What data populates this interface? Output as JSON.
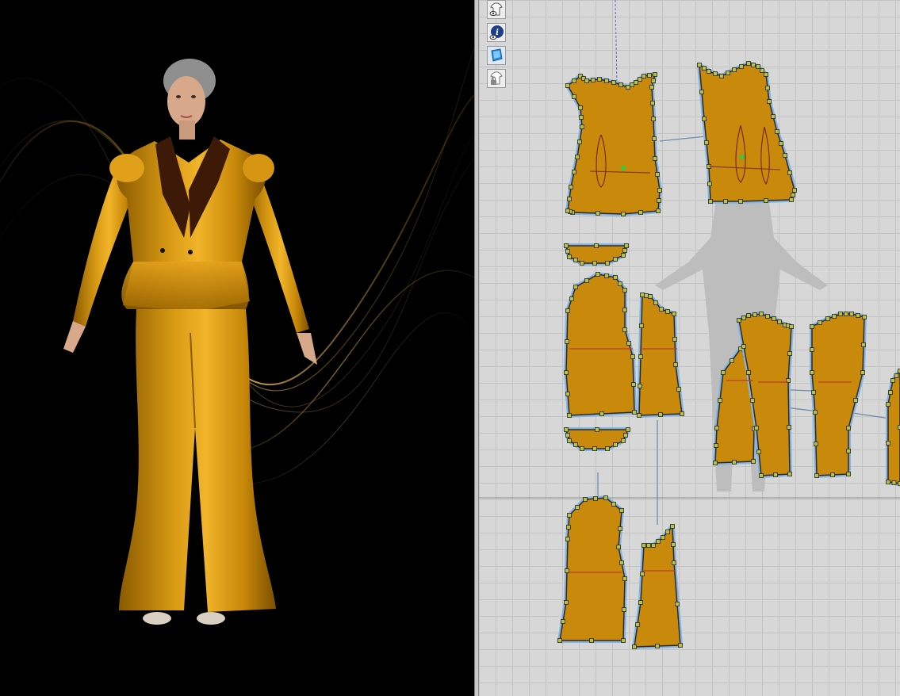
{
  "app": {
    "views": [
      "3d-garment-view",
      "2d-pattern-view"
    ]
  },
  "toolbar": {
    "tools": [
      {
        "icon": "garment-visibility-icon",
        "active": false
      },
      {
        "icon": "info-visibility-icon",
        "active": false
      },
      {
        "icon": "texture-fabric-icon",
        "active": true
      },
      {
        "icon": "lock-garment-icon",
        "active": false
      }
    ]
  },
  "colors": {
    "fabric": "#c98a0c",
    "fabric_dark": "#8a5a00",
    "lapel": "#3d1a08",
    "pattern_outline": "#86b6e0",
    "point": "#b7c24a",
    "grid_bg": "#d7d7d7",
    "avatar_silhouette": "#bdbdbd"
  }
}
